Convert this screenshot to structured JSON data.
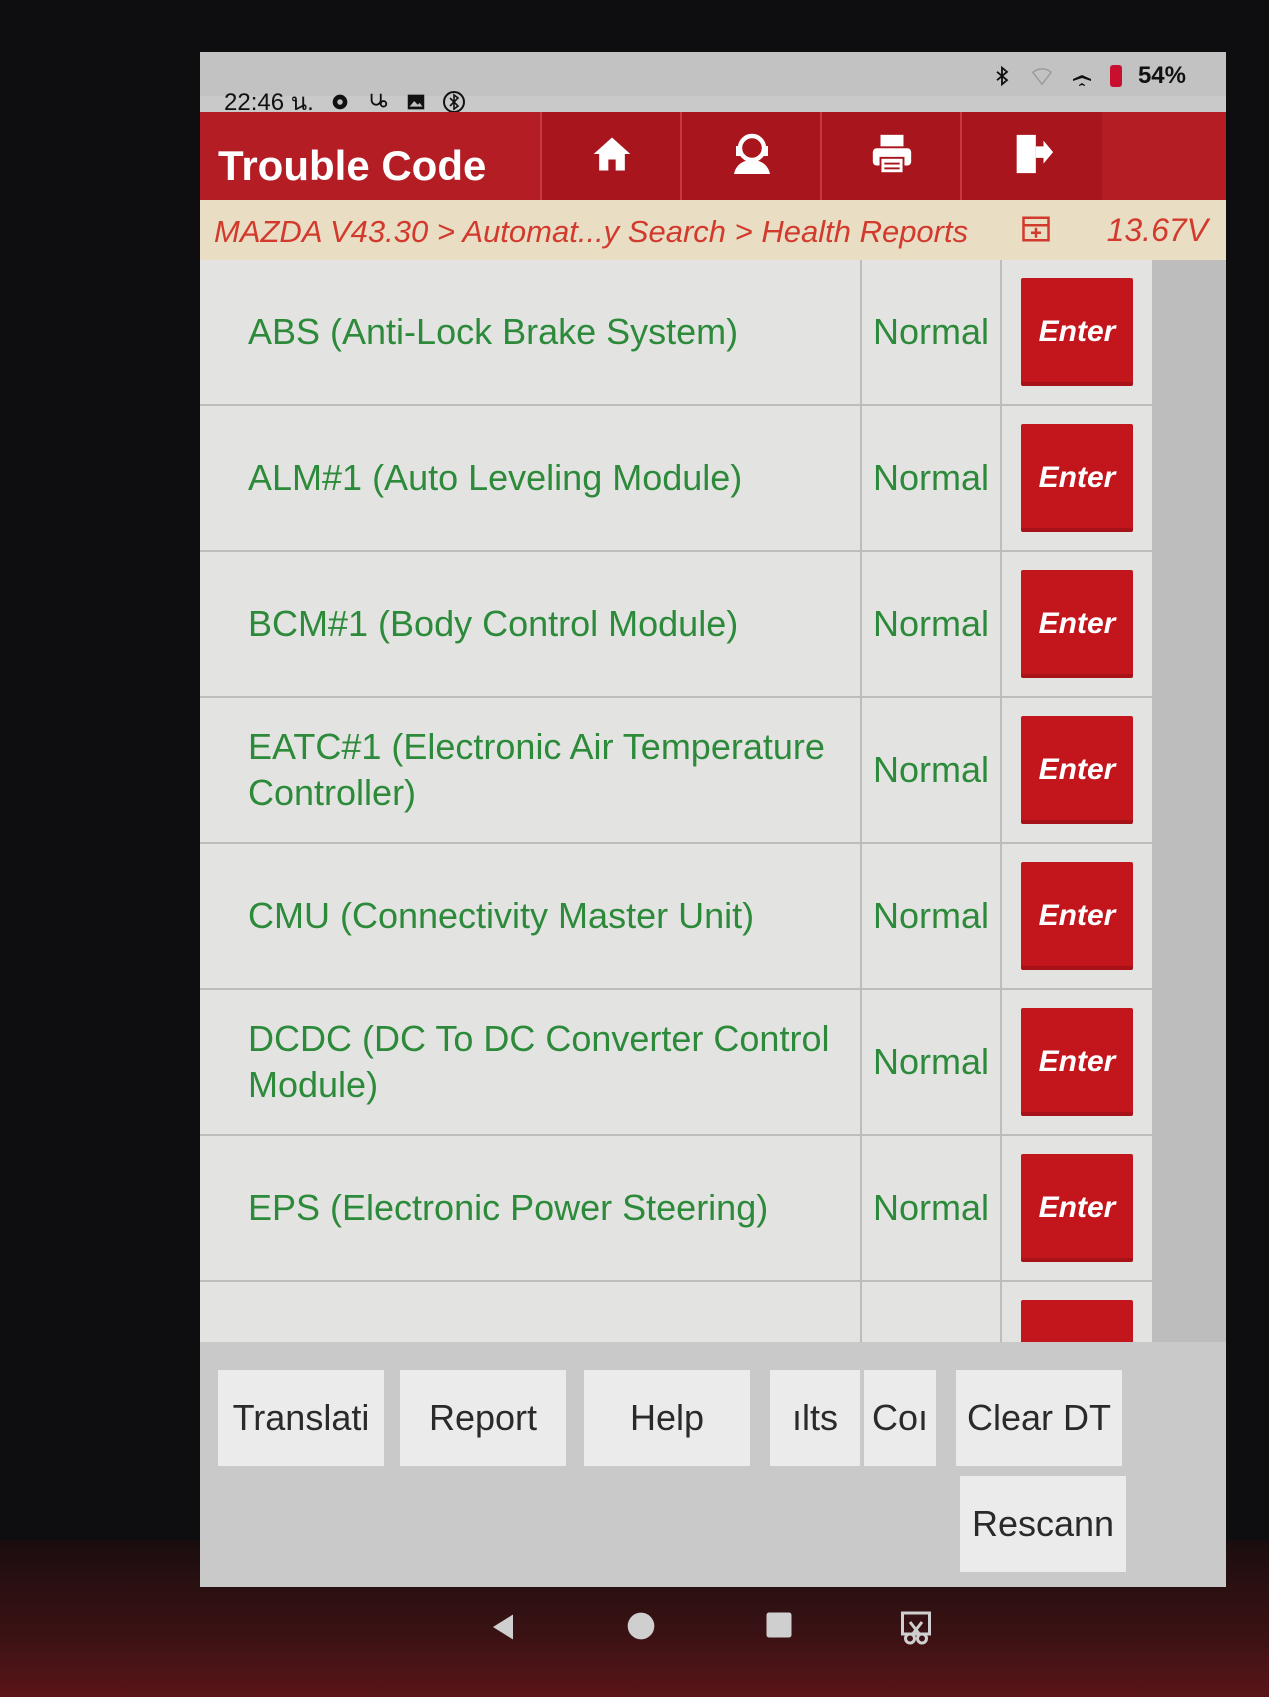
{
  "status_bar": {
    "time": "22:46 น.",
    "icons": [
      "gear-icon",
      "stethoscope-icon",
      "image-icon",
      "bluetooth-circle-icon"
    ],
    "right_icons": [
      "bluetooth-icon",
      "wifi-icon",
      "airplane-icon",
      "battery-icon"
    ],
    "battery": "54%"
  },
  "header": {
    "title": "Trouble Code",
    "buttons": [
      "home-icon",
      "user-support-icon",
      "print-icon",
      "exit-icon"
    ]
  },
  "breadcrumb": {
    "path": "MAZDA V43.30 > Automat...y Search > Health Reports",
    "voltage": "13.67V"
  },
  "systems": [
    {
      "name": "ABS (Anti-Lock Brake System)",
      "status": "Normal",
      "action": "Enter"
    },
    {
      "name": "ALM#1 (Auto Leveling Module)",
      "status": "Normal",
      "action": "Enter"
    },
    {
      "name": "BCM#1 (Body Control Module)",
      "status": "Normal",
      "action": "Enter"
    },
    {
      "name": "EATC#1 (Electronic Air Temperature Controller)",
      "status": "Normal",
      "action": "Enter"
    },
    {
      "name": "CMU (Connectivity Master Unit)",
      "status": "Normal",
      "action": "Enter"
    },
    {
      "name": "DCDC (DC To DC Converter Control Module)",
      "status": "Normal",
      "action": "Enter"
    },
    {
      "name": "EPS (Electronic Power Steering)",
      "status": "Normal",
      "action": "Enter"
    }
  ],
  "toolbar": {
    "translation": "Translati",
    "report": "Report",
    "help": "Help",
    "results": "ılts",
    "co": "Coı",
    "clear_dtc": "Clear DT",
    "rescan": "Rescann"
  },
  "colors": {
    "header_red": "#b51d24",
    "enter_red": "#c3161c",
    "status_green": "#2c8a3a",
    "breadcrumb_text": "#d13a2c"
  }
}
